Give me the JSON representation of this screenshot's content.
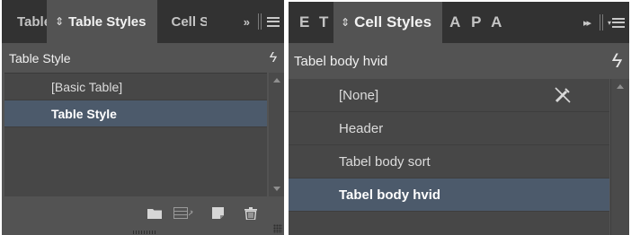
{
  "left_panel": {
    "tabs": [
      {
        "label": "Table",
        "active": false
      },
      {
        "label": "Table Styles",
        "active": true,
        "indicator": "⇕"
      },
      {
        "label": "Cell St",
        "active": false
      }
    ],
    "overflow": "»",
    "header": "Table Style",
    "items": [
      {
        "label": "[Basic Table]",
        "selected": false
      },
      {
        "label": "Table Style",
        "selected": true
      }
    ],
    "footer_icons": [
      "folder-icon",
      "load-styles-icon",
      "new-style-icon",
      "delete-icon"
    ]
  },
  "right_panel": {
    "tabs": [
      {
        "label": "E",
        "active": false
      },
      {
        "label": "T",
        "active": false
      },
      {
        "label": "Cell Styles",
        "active": true,
        "indicator": "⇕"
      },
      {
        "label": "A",
        "active": false
      },
      {
        "label": "P",
        "active": false
      },
      {
        "label": "A",
        "active": false
      }
    ],
    "overflow": "▸▸",
    "header": "Tabel body hvid",
    "items": [
      {
        "label": "[None]",
        "selected": false,
        "icon": "no-edit-icon"
      },
      {
        "label": "Header",
        "selected": false
      },
      {
        "label": "Tabel body sort",
        "selected": false
      },
      {
        "label": "Tabel body hvid",
        "selected": true
      }
    ]
  },
  "colors": {
    "panel_bg": "#535353",
    "tabbar_bg": "#323232",
    "list_bg": "#474747",
    "selection": "#4c5a6b"
  }
}
